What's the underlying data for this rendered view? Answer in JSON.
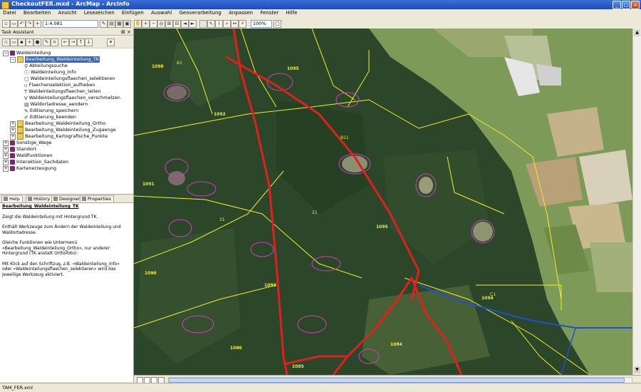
{
  "window": {
    "title": "CheckoutFER.mxd - ArcMap - ArcInfo",
    "buttons": [
      "minimize",
      "maximize",
      "close"
    ]
  },
  "menu": [
    "Datei",
    "Bearbeiten",
    "Ansicht",
    "Lesezeichen",
    "Einfügen",
    "Auswahl",
    "Geoverarbeitung",
    "Anpassen",
    "Fenster",
    "Hilfe"
  ],
  "toolbar": {
    "scale": "1:4.081",
    "zoom": "100%"
  },
  "task_assistant": {
    "title": "Task Assistant",
    "tree": [
      {
        "label": "Waldeinteilung",
        "icon": "book-icon",
        "expander": "−"
      },
      {
        "label": "Bearbeitung_Waldeinteilung_TK",
        "icon": "folder-icon",
        "expander": "−",
        "selected": true
      },
      {
        "label": "Abteilungssuche",
        "icon": "binoculars-icon"
      },
      {
        "label": "Waldeinteilung_Info",
        "icon": "info-icon"
      },
      {
        "label": "Waldeinteilungsflaechen_selektieren",
        "icon": "select-icon"
      },
      {
        "label": "Flaechenselektion_aufheben",
        "icon": "clear-icon"
      },
      {
        "label": "Waldeinteilungsflaechen_teilen",
        "icon": "split-icon"
      },
      {
        "label": "Waldeinteilungsflaechen_verschmelzen",
        "icon": "merge-icon"
      },
      {
        "label": "Waldortadresse_aendern",
        "icon": "edit-icon"
      },
      {
        "label": "Editierung_speichern",
        "icon": "save-icon"
      },
      {
        "label": "Editierung_beenden",
        "icon": "stop-icon"
      },
      {
        "label": "Bearbeitung_Waldeinteilung_Ortho",
        "icon": "folder-icon",
        "expander": "+"
      },
      {
        "label": "Bearbeitung_Waldeinteilung_Zugaenge",
        "icon": "folder-icon",
        "expander": "+"
      },
      {
        "label": "Bearbeitung_Kartografische_Punkte",
        "icon": "folder-icon",
        "expander": "+"
      },
      {
        "label": "Sonstige_Wege",
        "icon": "book-icon",
        "expander": "+"
      },
      {
        "label": "Standort",
        "icon": "book-icon",
        "expander": "+"
      },
      {
        "label": "Waldfunktionen",
        "icon": "book-icon",
        "expander": "+"
      },
      {
        "label": "Interaktion_Sachdaten",
        "icon": "book-icon",
        "expander": "+"
      },
      {
        "label": "Kartenerzeugung",
        "icon": "book-icon",
        "expander": "+"
      }
    ],
    "tabs": [
      "Help",
      "History",
      "Designer",
      "Properties"
    ],
    "help": {
      "title": "Bearbeitung_Waldeinteilung_TK",
      "p1": "Zeigt die Waldeinteilung mit Hintergrund TK.",
      "p2": "Enthält Werkzeuge zum Ändern der Waldeinteilung und Waldortadresse.",
      "p3": "Gleiche Funktionen wie Untermenü «Bearbeitung_Waldeinteilung_Ortho», nur anderer Hintergrund (TK anstatt Orthofoto).",
      "p4": "Mit Klick auf den Schriftzug, z.B. «Waldeinteilung_Info» oder «Waldeinteilungsflaechen_selektieren» wird das jeweilige Werkzeug aktiviert."
    }
  },
  "map": {
    "labels": [
      "1098",
      "1095",
      "1092",
      "1091",
      "1090",
      "1093",
      "1095",
      "1094",
      "1086",
      "1084",
      "1085",
      "A1",
      "B11",
      "C1",
      "21",
      "31"
    ],
    "colors": {
      "forest": "#2e4a2b",
      "field": "#8fa860",
      "line_red": "#e02020",
      "line_yellow": "#f0f020",
      "line_magenta": "#d040c0",
      "water": "#2050d0"
    }
  },
  "status": {
    "file": "TAM_FER.xml"
  }
}
